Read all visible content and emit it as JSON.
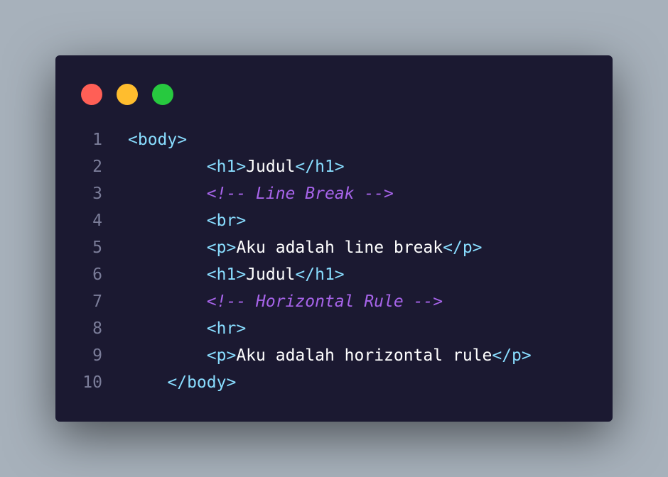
{
  "window": {
    "traffic_lights": [
      "close-dot",
      "minimize-dot",
      "maximize-dot"
    ]
  },
  "code": {
    "lines": [
      {
        "number": "1",
        "tokens": [
          {
            "type": "tag",
            "text": "<body>"
          }
        ]
      },
      {
        "number": "2",
        "tokens": [
          {
            "type": "text",
            "text": "        "
          },
          {
            "type": "tag",
            "text": "<h1>"
          },
          {
            "type": "text",
            "text": "Judul"
          },
          {
            "type": "tag",
            "text": "</h1>"
          }
        ]
      },
      {
        "number": "3",
        "tokens": [
          {
            "type": "text",
            "text": "        "
          },
          {
            "type": "comment",
            "text": "<!-- Line Break -->"
          }
        ]
      },
      {
        "number": "4",
        "tokens": [
          {
            "type": "text",
            "text": "        "
          },
          {
            "type": "tag",
            "text": "<br>"
          }
        ]
      },
      {
        "number": "5",
        "tokens": [
          {
            "type": "text",
            "text": "        "
          },
          {
            "type": "tag",
            "text": "<p>"
          },
          {
            "type": "text",
            "text": "Aku adalah line break"
          },
          {
            "type": "tag",
            "text": "</p>"
          }
        ]
      },
      {
        "number": "6",
        "tokens": [
          {
            "type": "text",
            "text": "        "
          },
          {
            "type": "tag",
            "text": "<h1>"
          },
          {
            "type": "text",
            "text": "Judul"
          },
          {
            "type": "tag",
            "text": "</h1>"
          }
        ]
      },
      {
        "number": "7",
        "tokens": [
          {
            "type": "text",
            "text": "        "
          },
          {
            "type": "comment",
            "text": "<!-- Horizontal Rule -->"
          }
        ]
      },
      {
        "number": "8",
        "tokens": [
          {
            "type": "text",
            "text": "        "
          },
          {
            "type": "tag",
            "text": "<hr>"
          }
        ]
      },
      {
        "number": "9",
        "tokens": [
          {
            "type": "text",
            "text": "        "
          },
          {
            "type": "tag",
            "text": "<p>"
          },
          {
            "type": "text",
            "text": "Aku adalah horizontal rule"
          },
          {
            "type": "tag",
            "text": "</p>"
          }
        ]
      },
      {
        "number": "10",
        "tokens": [
          {
            "type": "text",
            "text": "    "
          },
          {
            "type": "tag",
            "text": "</body>"
          }
        ]
      }
    ]
  },
  "colors": {
    "background": "#a7b1bb",
    "editor": "#1b1931",
    "tag": "#89ddff",
    "text": "#ffffff",
    "comment": "#a764ea",
    "line_number": "#7b7d99",
    "close": "#ff5f56",
    "minimize": "#ffbd2e",
    "maximize": "#27c93f"
  }
}
